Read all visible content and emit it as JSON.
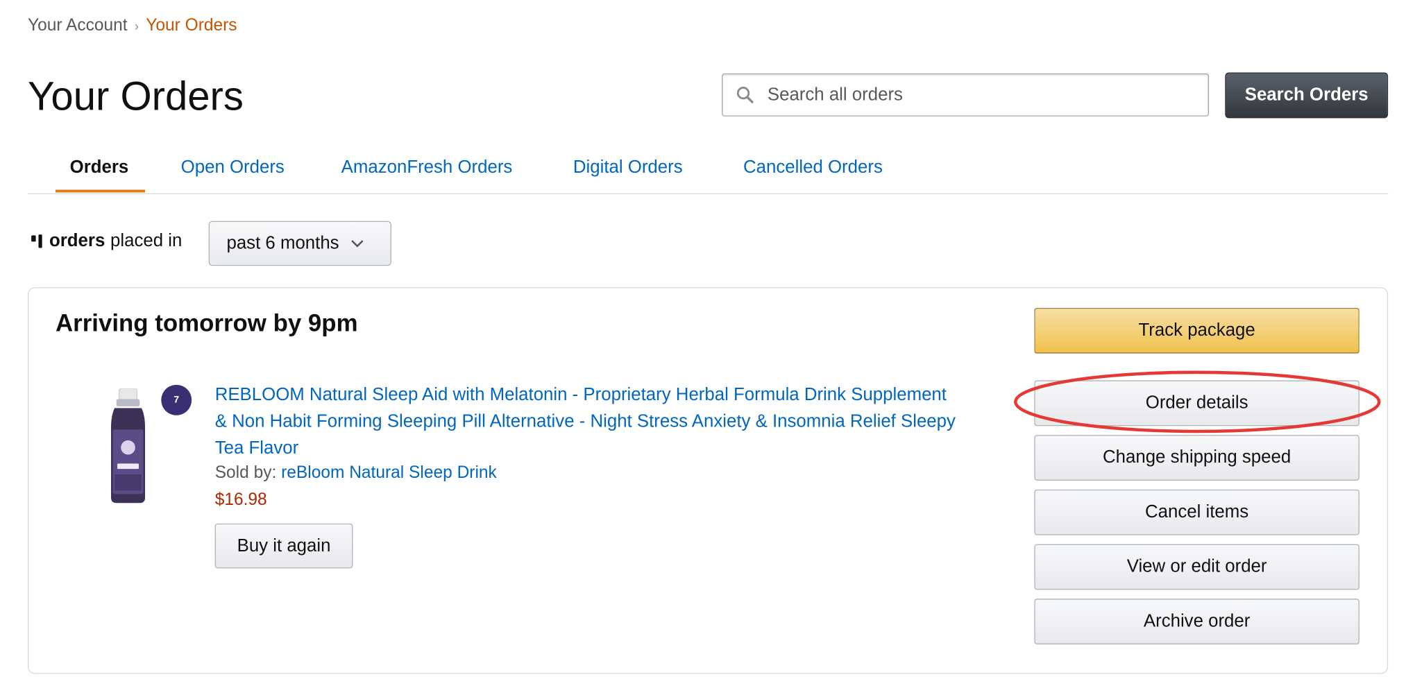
{
  "breadcrumb": {
    "parent": "Your Account",
    "separator": "›",
    "current": "Your Orders"
  },
  "page_title": "Your Orders",
  "search": {
    "placeholder": "Search all orders",
    "button_label": "Search Orders"
  },
  "tabs": [
    {
      "label": "Orders",
      "active": true
    },
    {
      "label": "Open Orders",
      "active": false
    },
    {
      "label": "AmazonFresh Orders",
      "active": false
    },
    {
      "label": "Digital Orders",
      "active": false
    },
    {
      "label": "Cancelled Orders",
      "active": false
    }
  ],
  "filter": {
    "orders_word": "orders",
    "placed_in_text": "placed in",
    "period_selected": "past 6 months"
  },
  "order": {
    "arrival_text": "Arriving tomorrow by 9pm",
    "item": {
      "title": "REBLOOM Natural Sleep Aid with Melatonin - Proprietary Herbal Formula Drink Supplement & Non Habit Forming Sleeping Pill Alternative - Night Stress Anxiety & Insomnia Relief Sleepy Tea Flavor",
      "sold_by_label": "Sold by:",
      "seller": "reBloom Natural Sleep Drink",
      "price": "$16.98",
      "quantity_badge": "7",
      "buy_again_label": "Buy it again"
    },
    "actions": [
      {
        "label": "Track package",
        "style": "primary"
      },
      {
        "label": "Order details",
        "style": "secondary",
        "highlighted": true
      },
      {
        "label": "Change shipping speed",
        "style": "secondary"
      },
      {
        "label": "Cancel items",
        "style": "secondary"
      },
      {
        "label": "View or edit order",
        "style": "secondary"
      },
      {
        "label": "Archive order",
        "style": "secondary"
      }
    ]
  },
  "colors": {
    "link": "#0066c0",
    "breadcrumb_current": "#c45500",
    "price": "#b12704",
    "tab_underline": "#e47911",
    "primary_button": "#f0c14b",
    "search_button": "#3a4048",
    "highlight_ellipse": "#e53935"
  },
  "icons": {
    "search": "magnifier-icon",
    "dropdown": "chevron-down-icon"
  }
}
